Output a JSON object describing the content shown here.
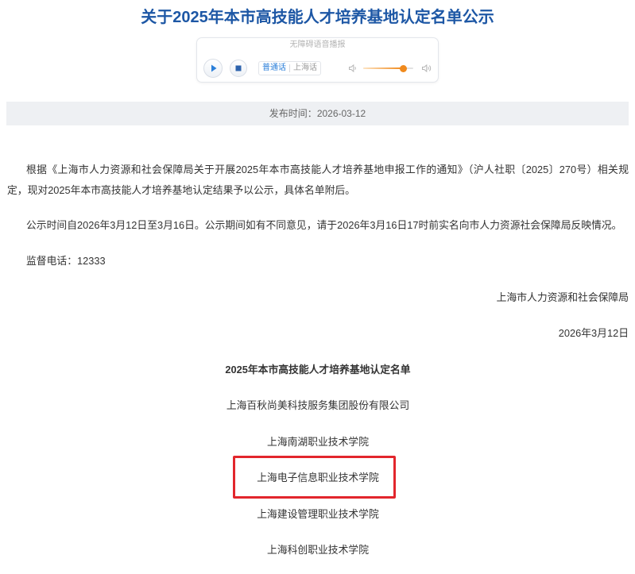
{
  "page": {
    "title": "关于2025年本市高技能人才培养基地认定名单公示"
  },
  "audio_player": {
    "header": "无障碍语音播报",
    "play_icon": "play-icon",
    "stop_icon": "stop-icon",
    "languages": [
      {
        "label": "普通话",
        "selected": true
      },
      {
        "label": "上海话",
        "selected": false
      }
    ],
    "volume_low_icon": "volume-low-icon",
    "volume_high_icon": "volume-high-icon",
    "volume": 0.8
  },
  "meta": {
    "publish_label": "发布时间：",
    "publish_date": "2026-03-12"
  },
  "body": {
    "paragraphs": [
      "根据《上海市人力资源和社会保障局关于开展2025年本市高技能人才培养基地申报工作的通知》（沪人社职〔2025〕270号）相关规定，现对2025年本市高技能人才培养基地认定结果予以公示，具体名单附后。",
      "公示时间自2026年3月12日至3月16日。公示期间如有不同意见，请于2026年3月16日17时前实名向市人力资源社会保障局反映情况。",
      "监督电话：12333"
    ],
    "signature": {
      "org": "上海市人力资源和社会保障局",
      "date": "2026年3月12日"
    }
  },
  "list": {
    "title": "2025年本市高技能人才培养基地认定名单",
    "items": [
      "上海百秋尚美科技服务集团股份有限公司",
      "上海南湖职业技术学院",
      "上海电子信息职业技术学院",
      "上海建设管理职业技术学院",
      "上海科创职业技术学院"
    ],
    "highlighted_item_index": 2
  },
  "theme": {
    "title_color": "#1d57a5",
    "text_color": "#333333",
    "muted_text": "#666666",
    "accent_blue": "#2b7fd9",
    "stop_blue": "#2e63ad",
    "volume_orange": "#f08a1d",
    "date_bar_bg": "#eef0f3",
    "highlight_red": "#e2262c"
  }
}
